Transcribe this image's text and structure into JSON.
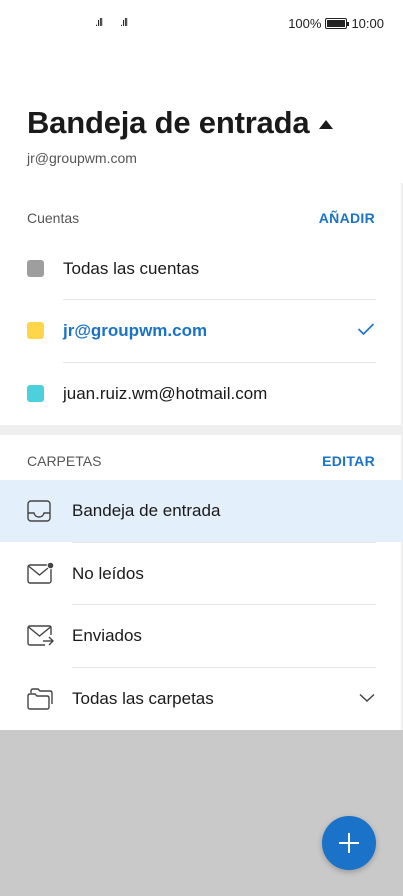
{
  "status_bar": {
    "signal_1": ".ıll",
    "signal_2": ".ıll",
    "battery_percent": "100%",
    "time": "10:00"
  },
  "header": {
    "title": "Bandeja de entrada",
    "subtitle": "jr@groupwm.com"
  },
  "accounts": {
    "section_label": "Cuentas",
    "action_label": "AÑADIR",
    "items": [
      {
        "label": "Todas las cuentas",
        "color": "#9e9e9e",
        "selected": false
      },
      {
        "label": "jr@groupwm.com",
        "color": "#ffd54a",
        "selected": true
      },
      {
        "label": "juan.ruiz.wm@hotmail.com",
        "color": "#4dd0de",
        "selected": false
      }
    ]
  },
  "folders": {
    "section_label": "CARPETAS",
    "action_label": "EDITAR",
    "items": [
      {
        "label": "Bandeja de entrada",
        "icon": "inbox-icon",
        "selected": true
      },
      {
        "label": "No leídos",
        "icon": "unread-mail-icon",
        "selected": false
      },
      {
        "label": "Enviados",
        "icon": "sent-mail-icon",
        "selected": false
      },
      {
        "label": "Todas las carpetas",
        "icon": "folders-icon",
        "selected": false
      }
    ]
  },
  "fab": {
    "icon": "plus-icon"
  },
  "colors": {
    "accent": "#1a73c8",
    "selected_bg": "#e3effb",
    "scrim": "#c9c9c9"
  }
}
